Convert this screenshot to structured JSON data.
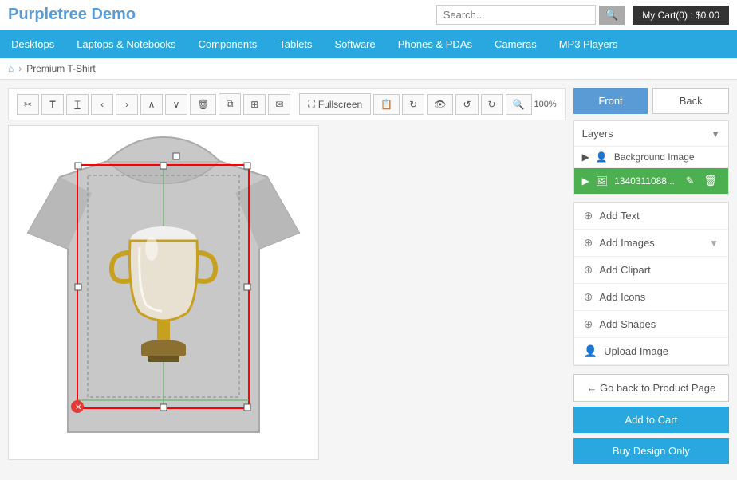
{
  "header": {
    "title": "Purpletree Demo",
    "search_placeholder": "Search...",
    "cart_label": "My Cart(0) : $0.00"
  },
  "nav": {
    "items": [
      "Desktops",
      "Laptops & Notebooks",
      "Components",
      "Tablets",
      "Software",
      "Phones & PDAs",
      "Cameras",
      "MP3 Players"
    ]
  },
  "breadcrumb": {
    "home_icon": "⌂",
    "separator": "›",
    "current": "Premium T-Shirt"
  },
  "toolbar": {
    "buttons": [
      "✂",
      "T",
      "T̲",
      "‹",
      "›",
      "∧",
      "∨",
      "🗑",
      "⧉",
      "⊞",
      "✉"
    ],
    "fullscreen": "Fullscreen",
    "zoom": "100%"
  },
  "layers": {
    "label": "Layers",
    "items": [
      {
        "name": "Background Image",
        "active": false,
        "icon": "👤"
      },
      {
        "name": "1340311088...",
        "active": true,
        "icon": "🖼"
      }
    ]
  },
  "tools": {
    "items": [
      {
        "label": "Add Text",
        "icon": "⊕"
      },
      {
        "label": "Add Images",
        "icon": "⊕",
        "has_arrow": true
      },
      {
        "label": "Add Clipart",
        "icon": "⊕"
      },
      {
        "label": "Add Icons",
        "icon": "⊕"
      },
      {
        "label": "Add Shapes",
        "icon": "⊕"
      },
      {
        "label": "Upload Image",
        "icon": "⊕"
      }
    ]
  },
  "side_buttons": {
    "front": "Front",
    "back": "Back"
  },
  "bottom_buttons": {
    "go_back": "← Go back to Product Page",
    "add_to_cart": "Add to Cart",
    "buy_design": "Buy Design Only"
  },
  "colors": {
    "accent_blue": "#29a8e0",
    "btn_blue": "#5b9bd5",
    "green": "#4caf50",
    "red": "#e53935"
  }
}
